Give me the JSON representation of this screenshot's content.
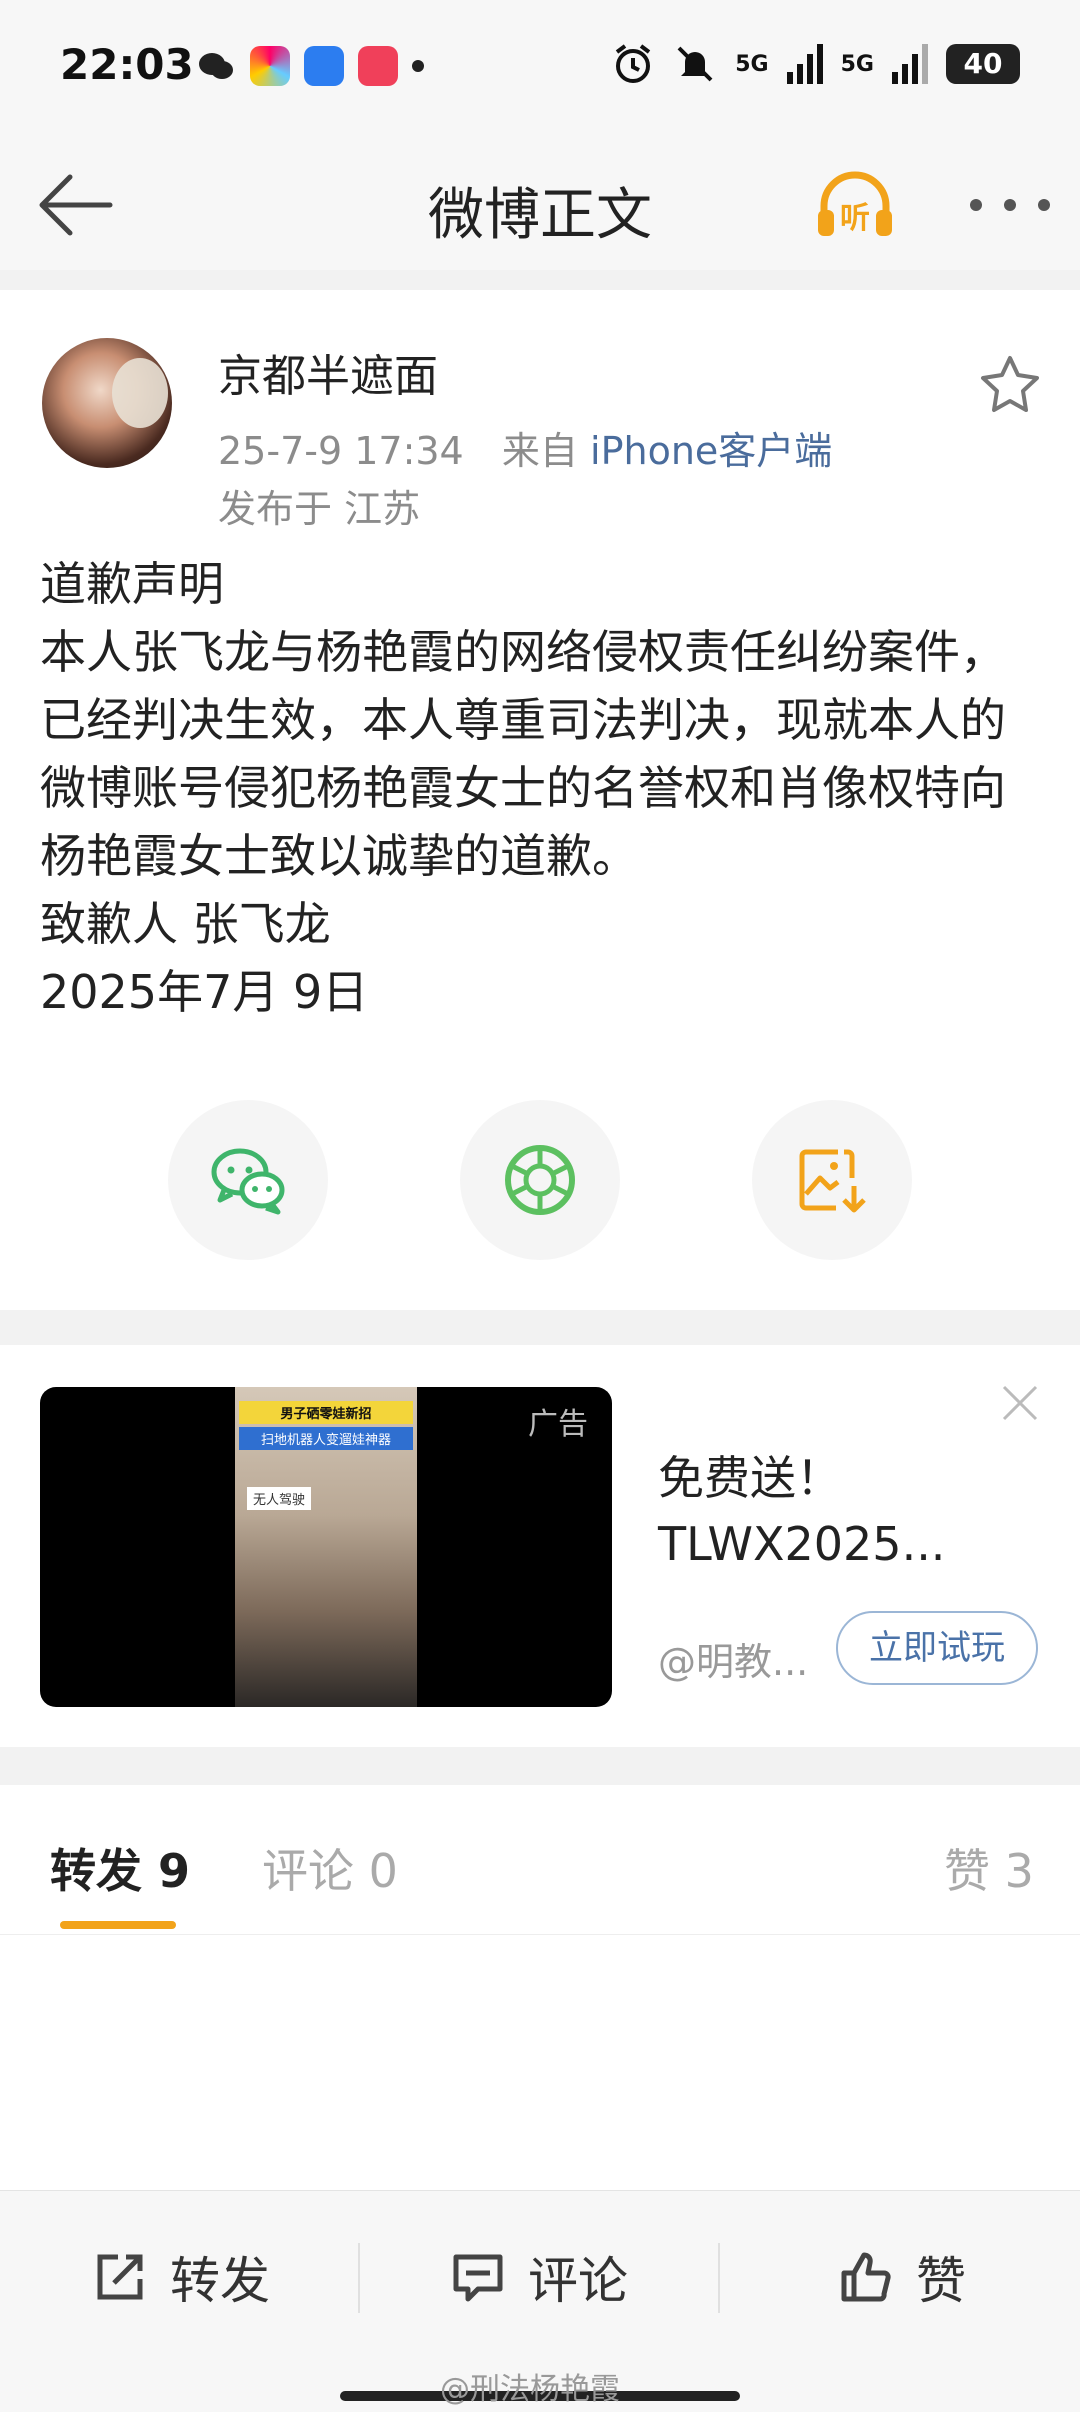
{
  "status_bar": {
    "time": "22:03",
    "network1": "5G",
    "network2": "5G",
    "battery": "40"
  },
  "nav": {
    "title": "微博正文"
  },
  "post": {
    "username": "京都半遮面",
    "date": "25-7-9 17:34",
    "source_prefix": "来自",
    "source": "iPhone客户端",
    "location": "发布于 江苏",
    "lines": [
      "道歉声明",
      "本人张飞龙与杨艳霞的网络侵权责任纠纷案件，已经判决生效，本人尊重司法判决，现就本人的微博账号侵犯杨艳霞女士的名誉权和肖像权特向杨艳霞女士致以诚挚的道歉。",
      "致歉人 张飞龙",
      "2025年7月 9日"
    ]
  },
  "ad": {
    "label": "广告",
    "title": "免费送！TLWX2025...",
    "advertiser": "@明教...",
    "cta": "立即试玩",
    "frame_caption1": "男子硒零娃新招",
    "frame_caption2": "扫地机器人变遛娃神器",
    "frame_tag": "无人驾驶"
  },
  "tabs": {
    "repost": "转发 9",
    "comment": "评论 0",
    "like": "赞 3"
  },
  "bottom": {
    "repost": "转发",
    "comment": "评论",
    "like": "赞"
  },
  "watermark": "@刑法杨艳霞",
  "colors": {
    "accent": "#f2a31a",
    "link": "#4a6c9c",
    "wechat": "#3fb56b"
  }
}
